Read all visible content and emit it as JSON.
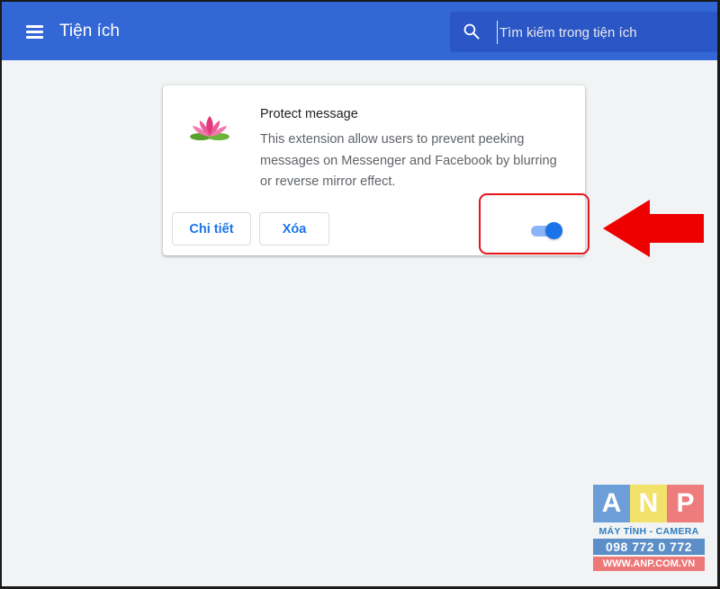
{
  "header": {
    "title": "Tiện ích",
    "menu_icon": "hamburger-menu-icon",
    "search": {
      "icon": "search-icon",
      "placeholder": "Tìm kiếm trong tiện ích",
      "value": ""
    }
  },
  "extension": {
    "icon": "lotus-flower-icon",
    "name": "Protect message",
    "description": "This extension allow users to prevent peeking messages on Messenger and Facebook by blurring or reverse mirror effect.",
    "details_label": "Chi tiết",
    "remove_label": "Xóa",
    "enabled": true
  },
  "annotation": {
    "highlight_color": "#e8141a",
    "arrow_icon": "red-arrow-left-icon"
  },
  "watermark": {
    "letters": [
      "A",
      "N",
      "P"
    ],
    "letter_colors": [
      "#6c9fd8",
      "#f2e16a",
      "#ee7c7c"
    ],
    "tagline": "MÁY TÍNH - CAMERA",
    "phone": "098 772 0 772",
    "website": "WWW.ANP.COM.VN"
  },
  "colors": {
    "header_bg": "#3367d6",
    "search_bg": "#2a56c6",
    "page_bg": "#f1f3f4",
    "accent": "#1a73e8"
  }
}
